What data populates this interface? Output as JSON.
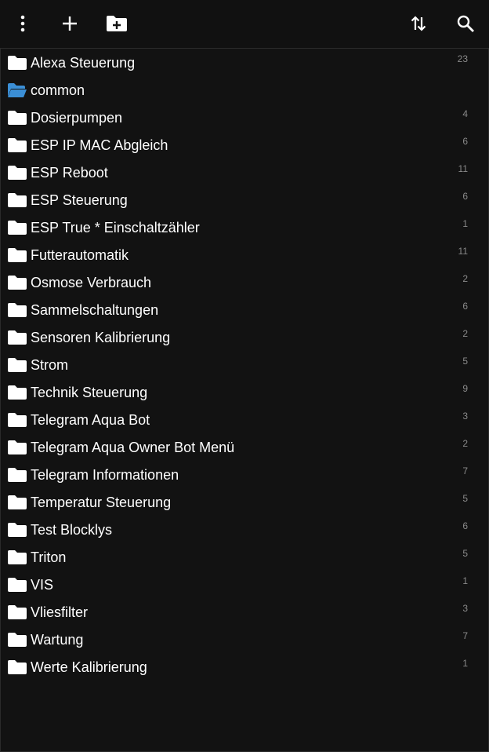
{
  "toolbar": {
    "menu_icon": "more-vert-icon",
    "add_icon": "add-icon",
    "add_folder_icon": "create-new-folder-icon",
    "sort_icon": "swap-vert-icon",
    "search_icon": "search-icon"
  },
  "colors": {
    "background": "#121212",
    "folder": "#ffffff",
    "folder_open": "#3b8fd6",
    "count": "#8a8a8a"
  },
  "folders": [
    {
      "name": "Alexa Steuerung",
      "count": "23",
      "open": false
    },
    {
      "name": "common",
      "count": "",
      "open": true
    },
    {
      "name": "Dosierpumpen",
      "count": "4",
      "open": false
    },
    {
      "name": "ESP IP MAC Abgleich",
      "count": "6",
      "open": false
    },
    {
      "name": "ESP Reboot",
      "count": "11",
      "open": false
    },
    {
      "name": "ESP Steuerung",
      "count": "6",
      "open": false
    },
    {
      "name": "ESP True * Einschaltzähler",
      "count": "1",
      "open": false
    },
    {
      "name": "Futterautomatik",
      "count": "11",
      "open": false
    },
    {
      "name": "Osmose Verbrauch",
      "count": "2",
      "open": false
    },
    {
      "name": "Sammelschaltungen",
      "count": "6",
      "open": false
    },
    {
      "name": "Sensoren Kalibrierung",
      "count": "2",
      "open": false
    },
    {
      "name": "Strom",
      "count": "5",
      "open": false
    },
    {
      "name": "Technik Steuerung",
      "count": "9",
      "open": false
    },
    {
      "name": "Telegram Aqua Bot",
      "count": "3",
      "open": false
    },
    {
      "name": "Telegram Aqua Owner Bot Menü",
      "count": "2",
      "open": false
    },
    {
      "name": "Telegram Informationen",
      "count": "7",
      "open": false
    },
    {
      "name": "Temperatur Steuerung",
      "count": "5",
      "open": false
    },
    {
      "name": "Test Blocklys",
      "count": "6",
      "open": false
    },
    {
      "name": "Triton",
      "count": "5",
      "open": false
    },
    {
      "name": "VIS",
      "count": "1",
      "open": false
    },
    {
      "name": "Vliesfilter",
      "count": "3",
      "open": false
    },
    {
      "name": "Wartung",
      "count": "7",
      "open": false
    },
    {
      "name": "Werte Kalibrierung",
      "count": "1",
      "open": false
    }
  ]
}
